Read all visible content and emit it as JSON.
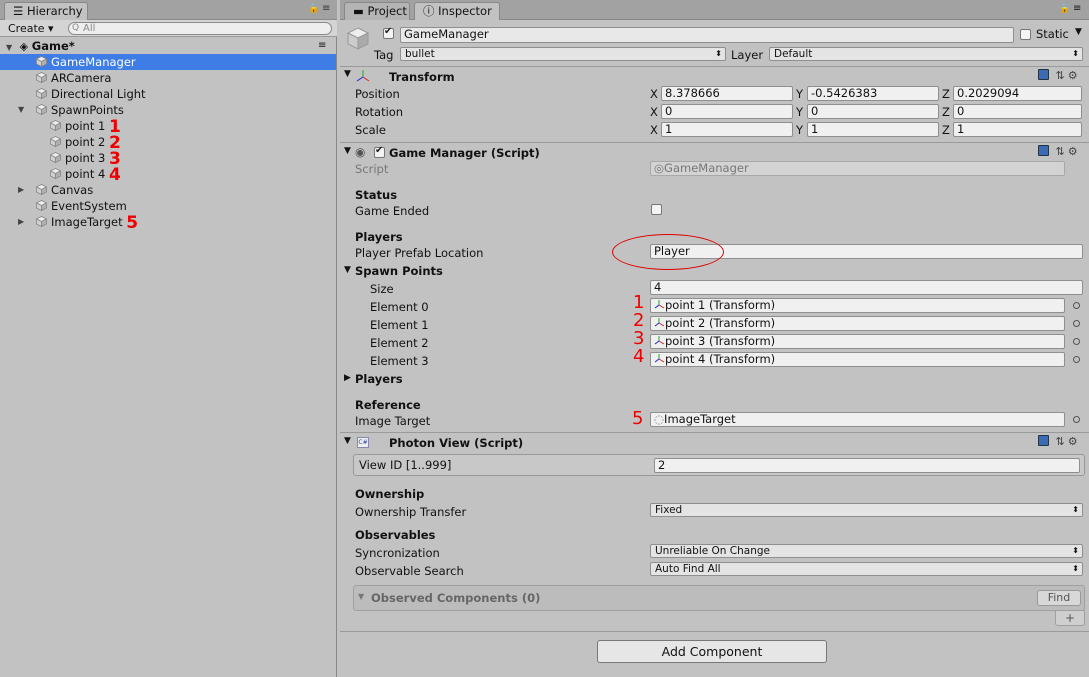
{
  "hierarchy": {
    "tab": "Hierarchy",
    "create": "Create",
    "search_placeholder": "All",
    "scene": "Game*",
    "items": [
      {
        "label": "GameManager"
      },
      {
        "label": "ARCamera"
      },
      {
        "label": "Directional Light"
      },
      {
        "label": "SpawnPoints"
      },
      {
        "label": "point 1",
        "mark": "1"
      },
      {
        "label": "point 2",
        "mark": "2"
      },
      {
        "label": "point 3",
        "mark": "3"
      },
      {
        "label": "point 4",
        "mark": "4"
      },
      {
        "label": "Canvas"
      },
      {
        "label": "EventSystem"
      },
      {
        "label": "ImageTarget",
        "mark": "5"
      }
    ]
  },
  "tabs": {
    "project": "Project",
    "inspector": "Inspector"
  },
  "object": {
    "name": "GameManager",
    "static_label": "Static",
    "tag_label": "Tag",
    "tag_value": "bullet",
    "layer_label": "Layer",
    "layer_value": "Default"
  },
  "transform": {
    "title": "Transform",
    "position_label": "Position",
    "rotation_label": "Rotation",
    "scale_label": "Scale",
    "axes": [
      "X",
      "Y",
      "Z"
    ],
    "position": [
      "8.378666",
      "-0.5426383",
      "0.2029094"
    ],
    "rotation": [
      "0",
      "0",
      "0"
    ],
    "scale": [
      "1",
      "1",
      "1"
    ]
  },
  "game_manager": {
    "title": "Game Manager (Script)",
    "script_label": "Script",
    "script_value": "GameManager",
    "status_header": "Status",
    "game_ended_label": "Game Ended",
    "players_header": "Players",
    "prefab_label": "Player Prefab Location",
    "prefab_value": "Player",
    "spawn_header": "Spawn Points",
    "size_label": "Size",
    "size_value": "4",
    "elements": [
      {
        "label": "Element 0",
        "value": "point 1 (Transform)",
        "mark": "1"
      },
      {
        "label": "Element 1",
        "value": "point 2 (Transform)",
        "mark": "2"
      },
      {
        "label": "Element 2",
        "value": "point 3 (Transform)",
        "mark": "3"
      },
      {
        "label": "Element 3",
        "value": "point 4 (Transform)",
        "mark": "4"
      }
    ],
    "players_foldout": "Players",
    "reference_header": "Reference",
    "image_target_label": "Image Target",
    "image_target_value": "ImageTarget",
    "image_target_mark": "5"
  },
  "photon": {
    "title": "Photon View (Script)",
    "viewid_label": "View ID [1..999]",
    "viewid_value": "2",
    "ownership_header": "Ownership",
    "transfer_label": "Ownership Transfer",
    "transfer_value": "Fixed",
    "observables_header": "Observables",
    "sync_label": "Syncronization",
    "sync_value": "Unreliable On Change",
    "search_label": "Observable Search",
    "search_value": "Auto Find All",
    "observed_label": "Observed Components (0)",
    "find_label": "Find",
    "plus": "+"
  },
  "add_component": "Add Component",
  "colors": {
    "selection": "#3e7ce6",
    "annotation": "#e00000",
    "panel": "#c2c2c2"
  }
}
